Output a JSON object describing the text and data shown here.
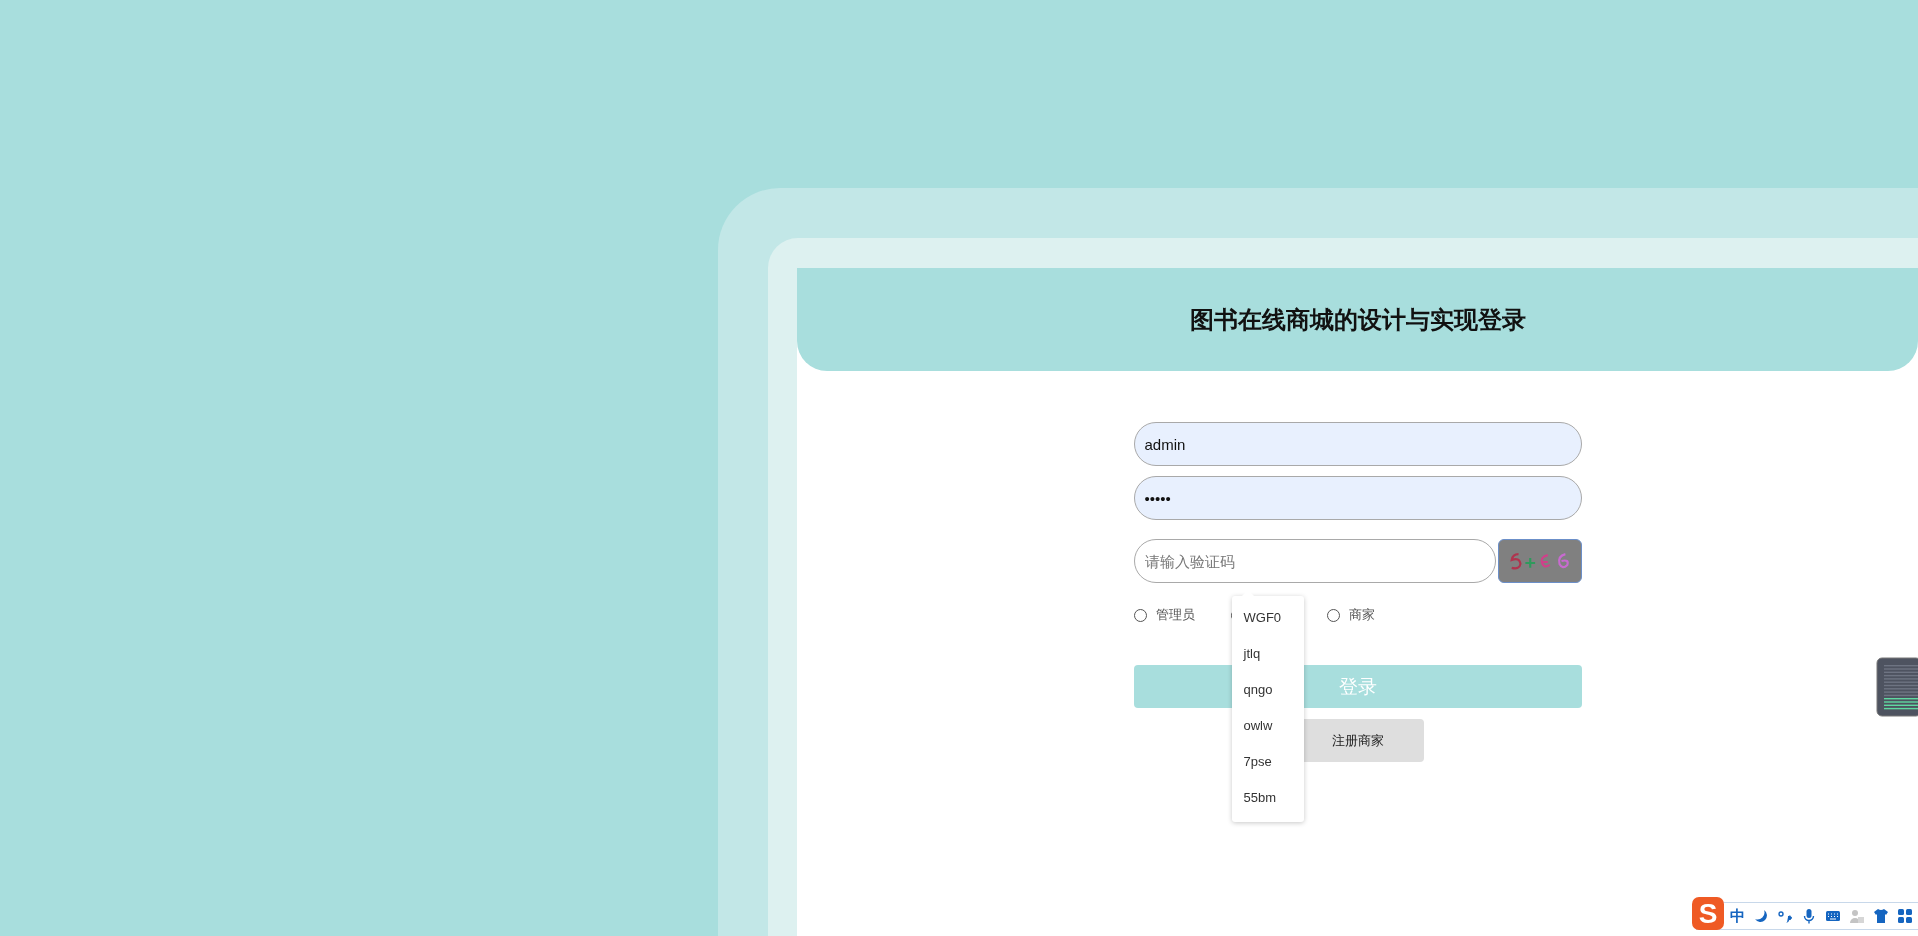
{
  "header": {
    "title": "图书在线商城的设计与实现登录"
  },
  "form": {
    "username": {
      "value": "admin"
    },
    "password": {
      "value": "•••••"
    },
    "captcha": {
      "placeholder": "请输入验证码"
    },
    "roles": [
      {
        "label": "管理员",
        "selected": false
      },
      {
        "selected": false
      },
      {
        "label": "商家",
        "selected": false
      }
    ],
    "login_button": "登录",
    "register_button": "注册商家"
  },
  "autocomplete": {
    "items": [
      "WGF0",
      "jtlq",
      "qngo",
      "owlw",
      "7pse",
      "55bm"
    ]
  },
  "ime_toolbar": {
    "logo": "S",
    "mode": "中"
  }
}
